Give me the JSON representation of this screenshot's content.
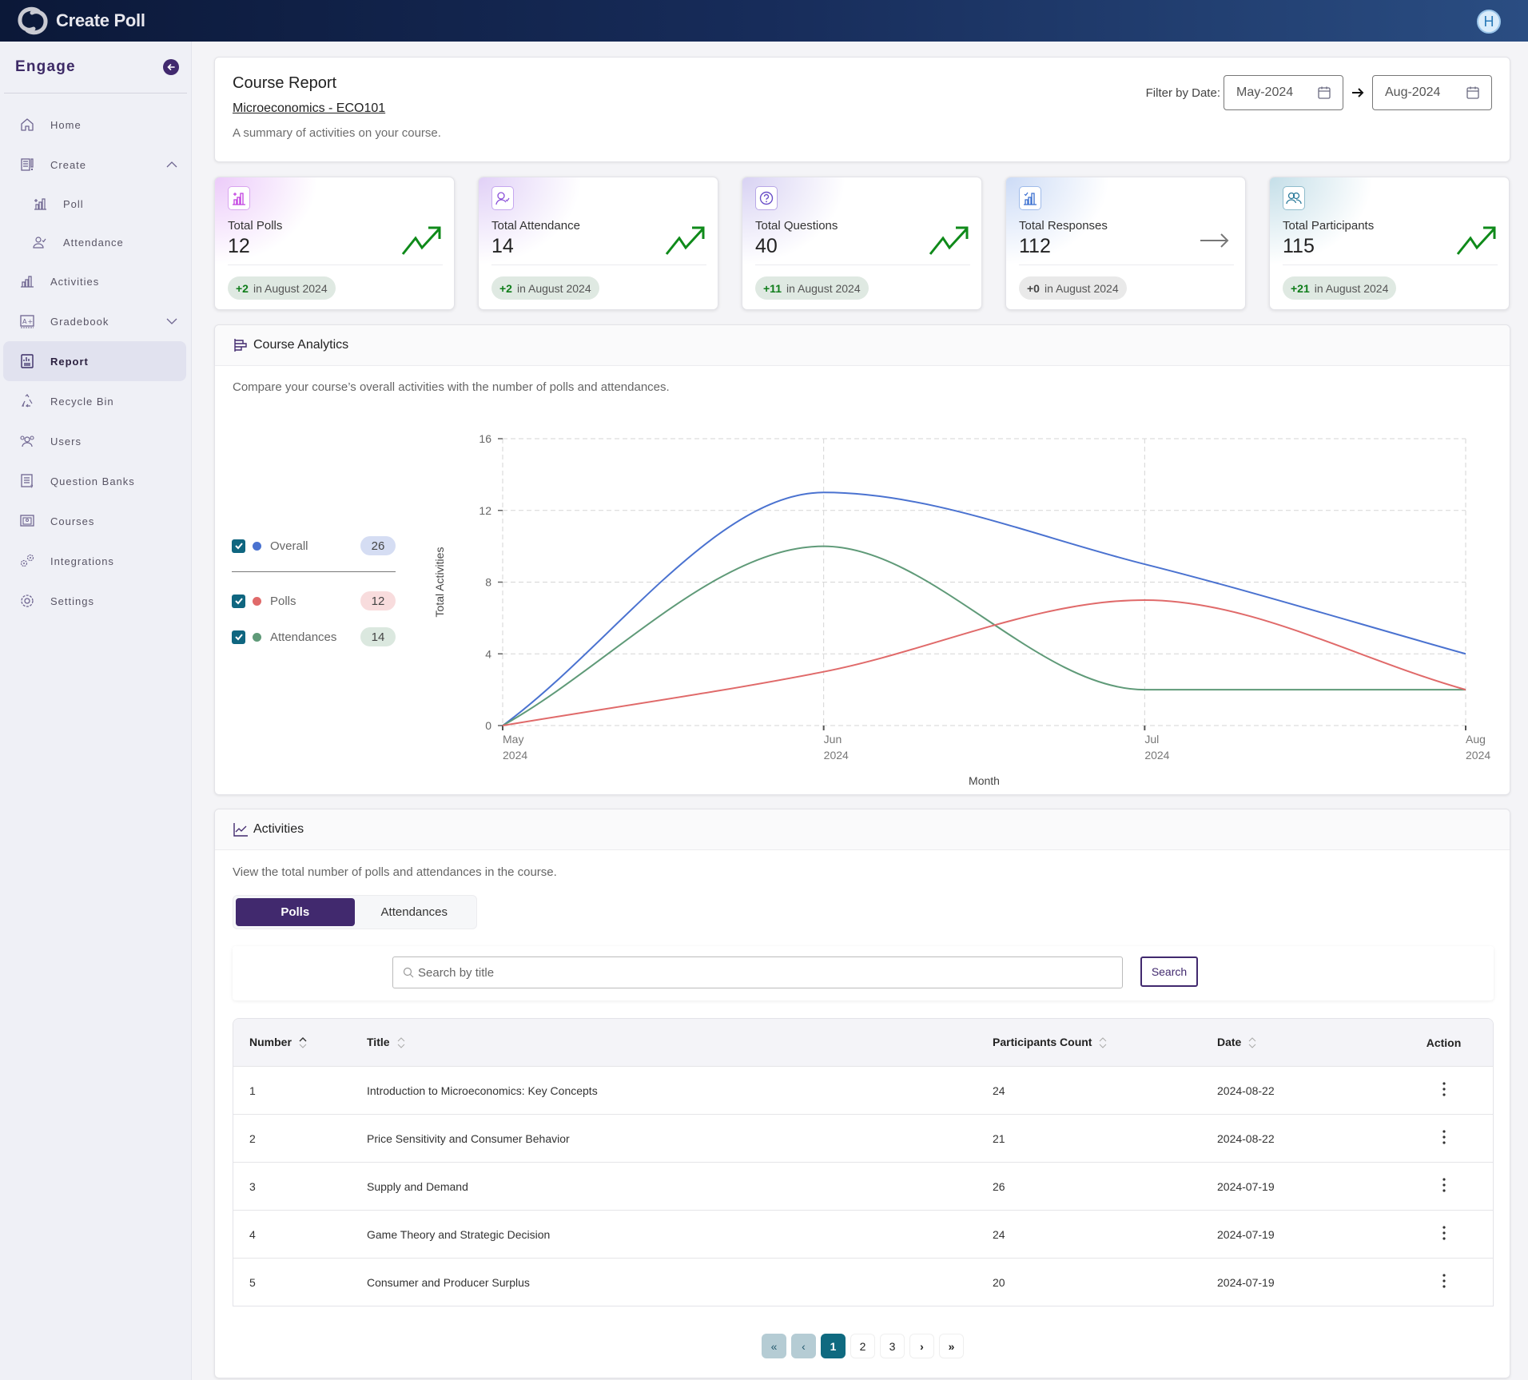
{
  "app": {
    "title": "Create Poll",
    "user_initial": "H"
  },
  "sidebar": {
    "title": "Engage",
    "items": [
      {
        "label": "Home",
        "icon": "home-icon"
      },
      {
        "label": "Create",
        "icon": "create-icon",
        "expanded": true
      },
      {
        "label": "Poll",
        "icon": "poll-icon",
        "sub": true
      },
      {
        "label": "Attendance",
        "icon": "attendance-icon",
        "sub": true
      },
      {
        "label": "Activities",
        "icon": "activities-icon"
      },
      {
        "label": "Gradebook",
        "icon": "gradebook-icon",
        "expanded": false
      },
      {
        "label": "Report",
        "icon": "report-icon",
        "active": true
      },
      {
        "label": "Recycle Bin",
        "icon": "recycle-icon"
      },
      {
        "label": "Users",
        "icon": "users-icon"
      },
      {
        "label": "Question Banks",
        "icon": "question-bank-icon"
      },
      {
        "label": "Courses",
        "icon": "courses-icon"
      },
      {
        "label": "Integrations",
        "icon": "integrations-icon"
      },
      {
        "label": "Settings",
        "icon": "settings-icon"
      }
    ]
  },
  "report": {
    "title": "Course Report",
    "course": "Microeconomics - ECO101",
    "description": "A summary of activities on your course.",
    "filter_label": "Filter by Date:",
    "date_from": "May-2024",
    "date_to": "Aug-2024"
  },
  "stats": [
    {
      "label": "Total Polls",
      "value": "12",
      "delta": "+2",
      "period": "in August 2024",
      "trend": "up",
      "accent": "#c13fe0"
    },
    {
      "label": "Total Attendance",
      "value": "14",
      "delta": "+2",
      "period": "in August 2024",
      "trend": "up",
      "accent": "#8a4fd8"
    },
    {
      "label": "Total Questions",
      "value": "40",
      "delta": "+11",
      "period": "in August 2024",
      "trend": "up",
      "accent": "#6a4fc8"
    },
    {
      "label": "Total Responses",
      "value": "112",
      "delta": "+0",
      "period": "in August 2024",
      "trend": "flat",
      "accent": "#3a6fd0"
    },
    {
      "label": "Total Participants",
      "value": "115",
      "delta": "+21",
      "period": "in August 2024",
      "trend": "up",
      "accent": "#2a7a9a"
    }
  ],
  "analytics": {
    "title": "Course Analytics",
    "description": "Compare your course’s overall activities with the number of polls and attendances.",
    "legend": [
      {
        "name": "Overall",
        "count": "26",
        "color": "#4a72d0",
        "pill_bg": "#d5ddf3",
        "checked": true
      },
      {
        "name": "Polls",
        "count": "12",
        "color": "#e06a6a",
        "pill_bg": "#f8dcdd",
        "checked": true
      },
      {
        "name": "Attendances",
        "count": "14",
        "color": "#5f9a78",
        "pill_bg": "#dbe8df",
        "checked": true
      }
    ]
  },
  "chart_data": {
    "type": "line",
    "title": "",
    "xlabel": "Month",
    "ylabel": "Total Activities",
    "categories": [
      "May 2024",
      "Jun 2024",
      "Jul 2024",
      "Aug 2024"
    ],
    "x_tick_lines": [
      [
        "May",
        "2024"
      ],
      [
        "Jun",
        "2024"
      ],
      [
        "Jul",
        "2024"
      ],
      [
        "Aug",
        "2024"
      ]
    ],
    "y_ticks": [
      0,
      4,
      8,
      12,
      16
    ],
    "ylim": [
      0,
      16
    ],
    "grid": true,
    "legend_position": "left",
    "series": [
      {
        "name": "Overall",
        "values": [
          0,
          13,
          9,
          4
        ],
        "color": "#4a72d0"
      },
      {
        "name": "Attendances",
        "values": [
          0,
          10,
          2,
          2
        ],
        "color": "#5f9a78"
      },
      {
        "name": "Polls",
        "values": [
          0,
          3,
          7,
          2
        ],
        "color": "#e06a6a"
      }
    ]
  },
  "activities": {
    "title": "Activities",
    "description": "View the total number of polls and attendances in the course.",
    "tabs": [
      {
        "label": "Polls",
        "active": true
      },
      {
        "label": "Attendances",
        "active": false
      }
    ],
    "search_placeholder": "Search by title",
    "search_button": "Search",
    "columns": [
      "Number",
      "Title",
      "Participants Count",
      "Date",
      "Action"
    ],
    "rows": [
      {
        "number": "1",
        "title": "Introduction to Microeconomics: Key Concepts",
        "participants": "24",
        "date": "2024-08-22"
      },
      {
        "number": "2",
        "title": "Price Sensitivity and Consumer Behavior",
        "participants": "21",
        "date": "2024-08-22"
      },
      {
        "number": "3",
        "title": "Supply and Demand",
        "participants": "26",
        "date": "2024-07-19"
      },
      {
        "number": "4",
        "title": "Game Theory and Strategic Decision",
        "participants": "24",
        "date": "2024-07-19"
      },
      {
        "number": "5",
        "title": "Consumer and Producer Surplus",
        "participants": "20",
        "date": "2024-07-19"
      }
    ],
    "pagination": {
      "first": "«",
      "prev": "‹",
      "pages": [
        "1",
        "2",
        "3"
      ],
      "current": "1",
      "next": "›",
      "last": "»"
    }
  }
}
